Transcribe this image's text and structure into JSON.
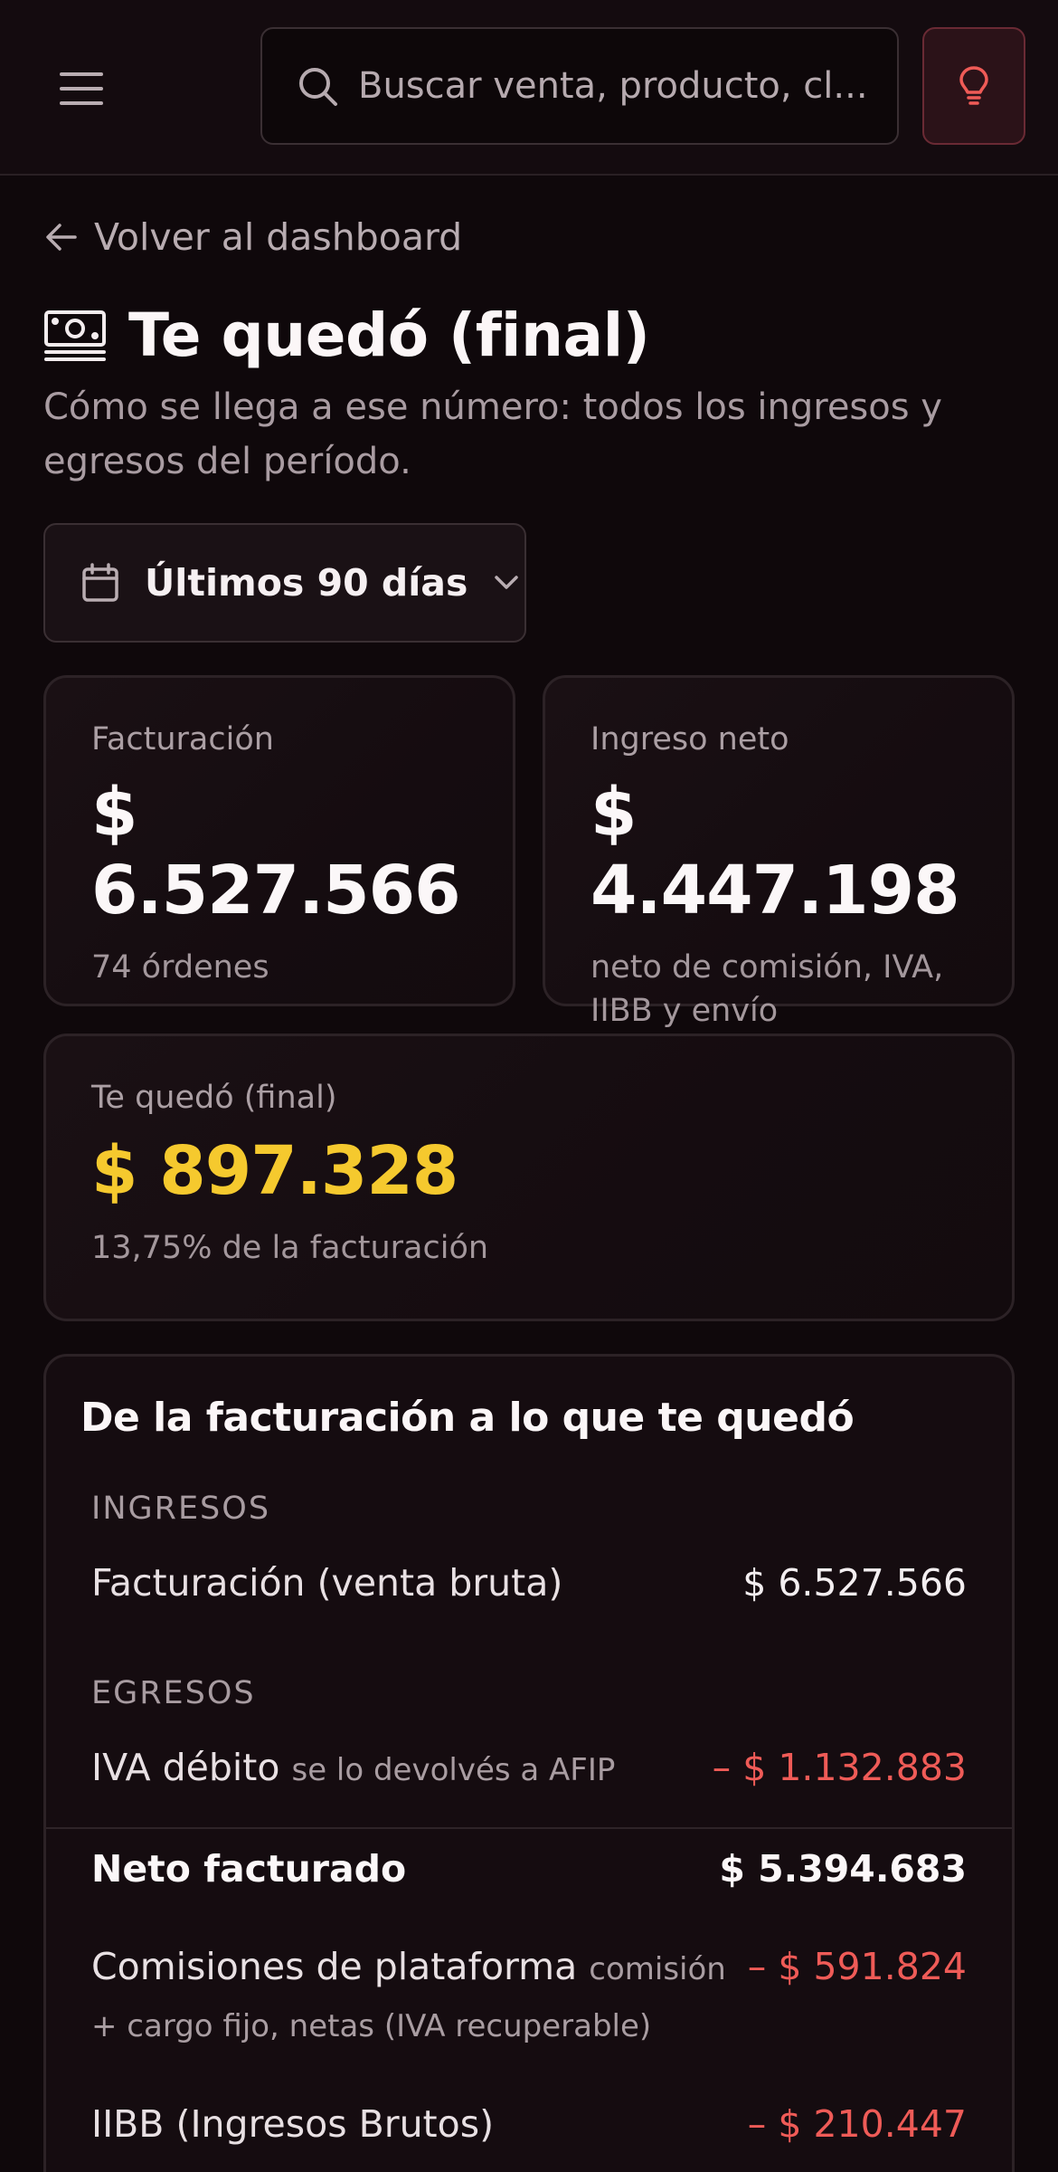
{
  "search": {
    "placeholder": "Buscar venta, producto, cl..."
  },
  "nav": {
    "back_label": "Volver al dashboard"
  },
  "page": {
    "title": "Te quedó (final)",
    "subtitle": "Cómo se llega a ese número: todos los ingresos y egresos del período."
  },
  "filter": {
    "range_label": "Últimos 90 días"
  },
  "kpis": {
    "billing": {
      "label": "Facturación",
      "value": "$ 6.527.566",
      "sub": "74 órdenes"
    },
    "net_income": {
      "label": "Ingreso neto",
      "value": "$ 4.447.198",
      "sub": "neto de comisión, IVA, IIBB y envío"
    },
    "final": {
      "label": "Te quedó (final)",
      "value": "$ 897.328",
      "sub": "13,75% de la facturación"
    }
  },
  "breakdown": {
    "title": "De la facturación a lo que te quedó",
    "income_label": "INGRESOS",
    "expenses_label": "EGRESOS",
    "rows": [
      {
        "name": "Facturación (venta bruta)",
        "note": "",
        "amount": "$ 6.527.566"
      },
      {
        "name": "IVA débito",
        "note": "se lo devolvés a AFIP",
        "amount": "– $ 1.132.883"
      },
      {
        "name": "Neto facturado",
        "note": "",
        "amount": "$ 5.394.683"
      },
      {
        "name": "Comisiones de plataforma",
        "note": "comisión + cargo fijo, netas (IVA recuperable)",
        "amount": "– $ 591.824"
      },
      {
        "name": "IIBB (Ingresos Brutos)",
        "note": "",
        "amount": "– $ 210.447"
      }
    ]
  },
  "colors": {
    "accent_final": "#f5c92e",
    "negative": "#ef5b57",
    "idea_button": "#2b1218"
  },
  "icons": [
    "menu-icon",
    "search-icon",
    "lightbulb-icon",
    "arrow-left-icon",
    "money-icon",
    "calendar-icon",
    "chevron-down-icon"
  ]
}
